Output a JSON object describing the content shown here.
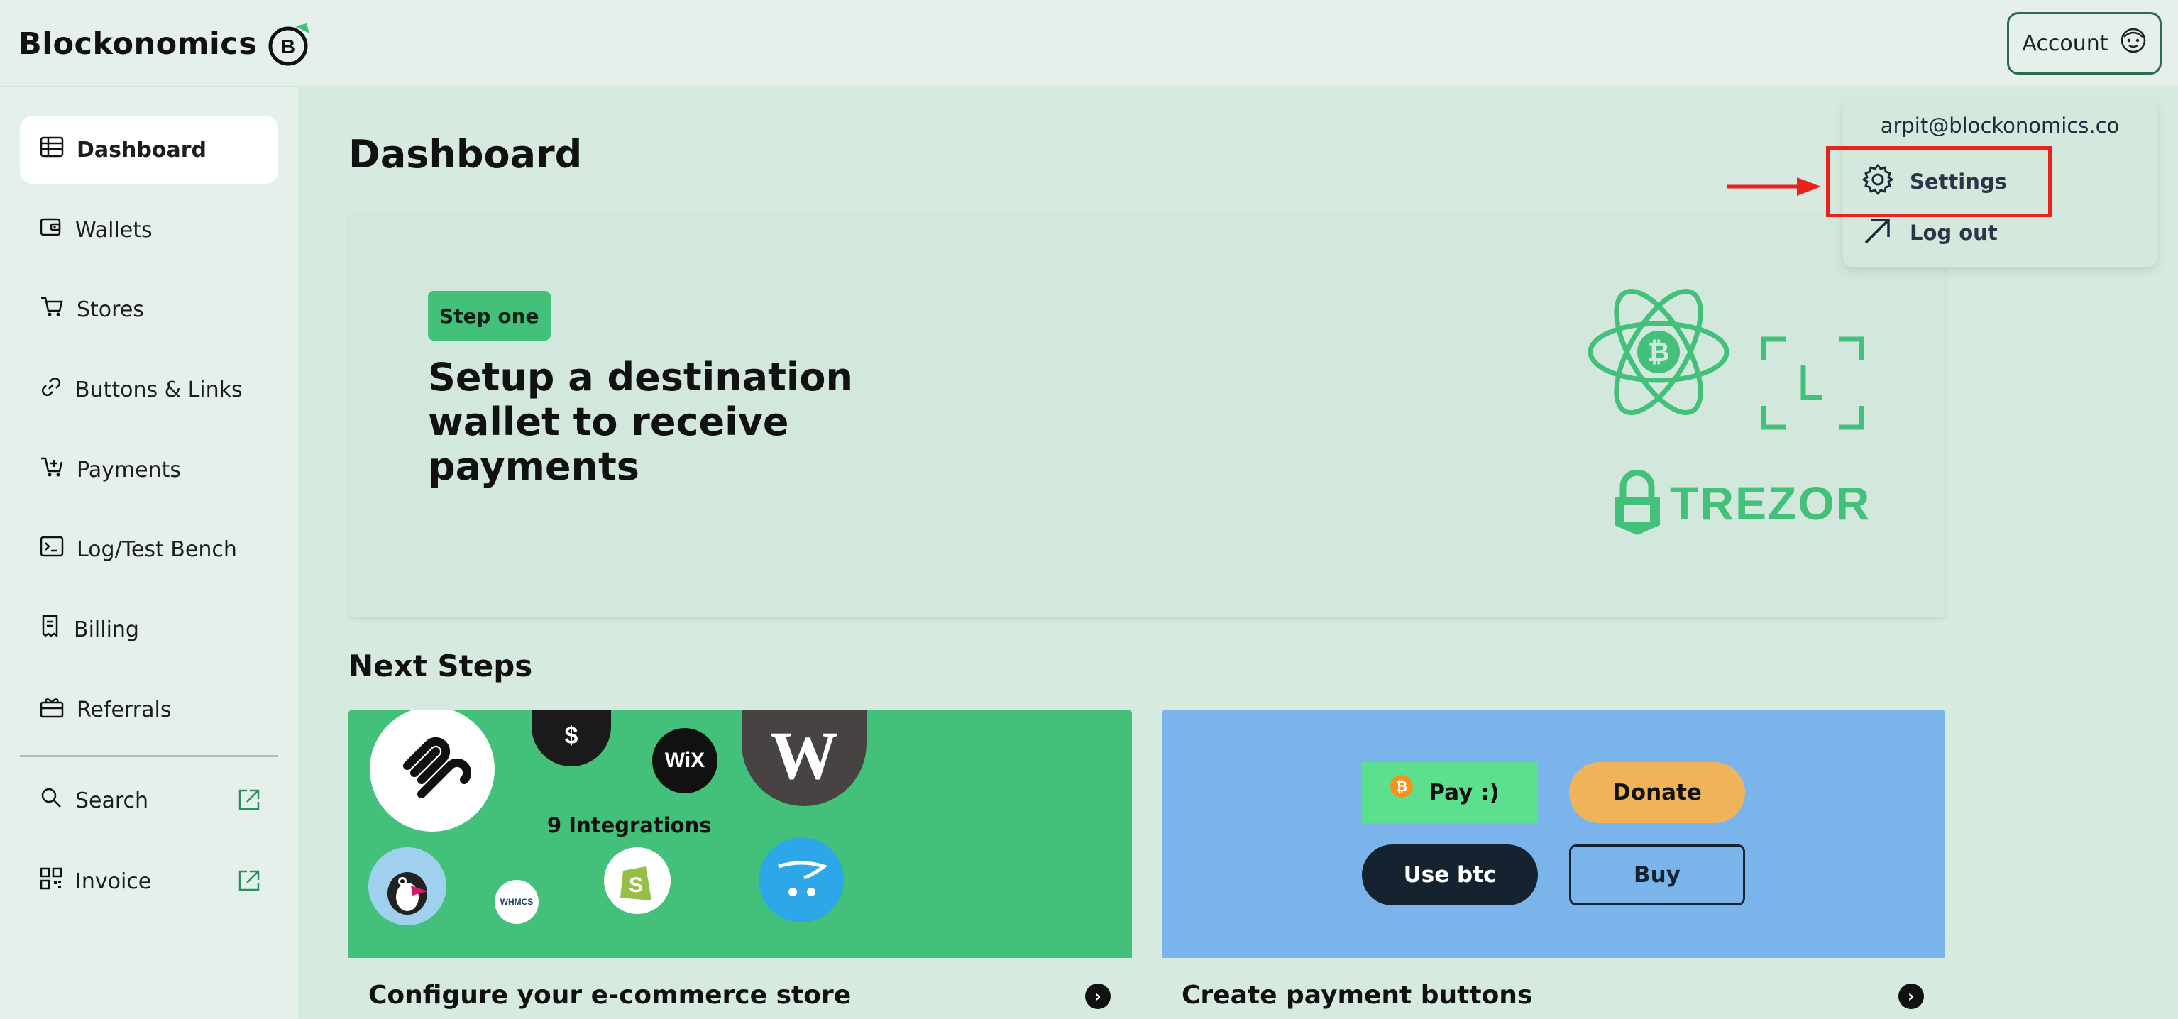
{
  "brand": {
    "name": "Blockonomics",
    "logo_letter": "B"
  },
  "header": {
    "account_label": "Account"
  },
  "sidebar": {
    "items": [
      {
        "label": "Dashboard",
        "icon": "table-icon",
        "active": true
      },
      {
        "label": "Wallets",
        "icon": "wallet-icon"
      },
      {
        "label": "Stores",
        "icon": "cart-icon"
      },
      {
        "label": "Buttons & Links",
        "icon": "link-icon"
      },
      {
        "label": "Payments",
        "icon": "cart-plus-icon"
      },
      {
        "label": "Log/Test Bench",
        "icon": "terminal-icon"
      },
      {
        "label": "Billing",
        "icon": "receipt-icon"
      },
      {
        "label": "Referrals",
        "icon": "gift-icon"
      }
    ],
    "external": [
      {
        "label": "Search",
        "icon": "search-icon"
      },
      {
        "label": "Invoice",
        "icon": "qr-icon"
      }
    ]
  },
  "main": {
    "title": "Dashboard",
    "hero": {
      "badge": "Step one",
      "heading": "Setup a destination wallet to receive payments",
      "brand_logo_text": "TREZOR"
    },
    "next_steps_title": "Next Steps",
    "cards": [
      {
        "label": "Configure your e-commerce store",
        "integrations_text": "9 Integrations",
        "logo_texts": [
          "WiX",
          "WHMCS"
        ]
      },
      {
        "label": "Create payment buttons",
        "buttons": [
          "Pay :)",
          "Donate",
          "Use btc",
          "Buy"
        ]
      }
    ]
  },
  "account_menu": {
    "email": "arpit@blockonomics.co",
    "items": [
      {
        "label": "Settings",
        "icon": "gear-icon"
      },
      {
        "label": "Log out",
        "icon": "arrow-up-left-icon"
      }
    ]
  },
  "colors": {
    "accent": "#43c07a",
    "sidebar_bg": "#e6f0eb",
    "main_bg": "#d6eadf",
    "card_blue": "#7ab4ea",
    "highlight": "#e8231c"
  }
}
